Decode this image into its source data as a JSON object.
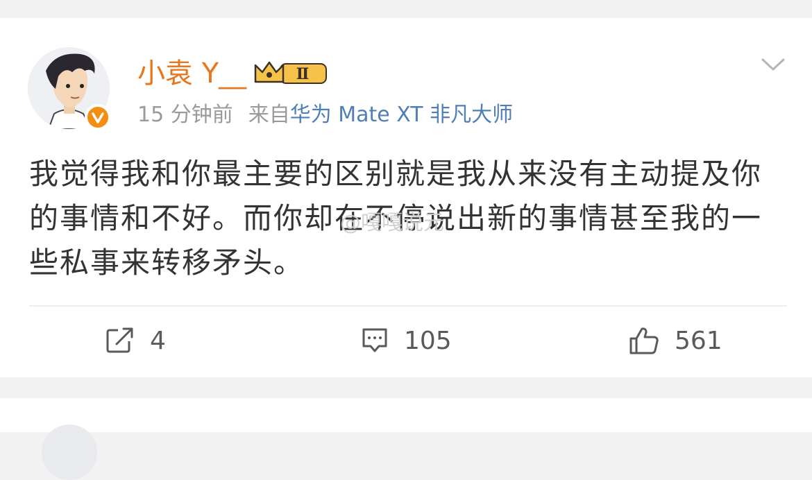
{
  "post": {
    "username": "小袁 Y__",
    "vip_level": "Ⅱ",
    "time": "15 分钟前",
    "source_prefix": "来自",
    "device": "华为 Mate XT 非凡大师",
    "text": "我觉得我和你最主要的区别就是我从来没有主动提及你的事情和不好。而你却在不停说出新的事情甚至我的一些私事来转移矛头。",
    "watermark": "@嘎嘎说元"
  },
  "actions": {
    "repost_count": "4",
    "comment_count": "105",
    "like_count": "561"
  },
  "colors": {
    "username": "#e8761d",
    "device": "#4f7fb6",
    "verified": "#f48d12"
  },
  "icons": [
    "chevron-down-icon",
    "crown-vip-icon",
    "verified-icon",
    "repost-icon",
    "comment-icon",
    "like-icon"
  ]
}
